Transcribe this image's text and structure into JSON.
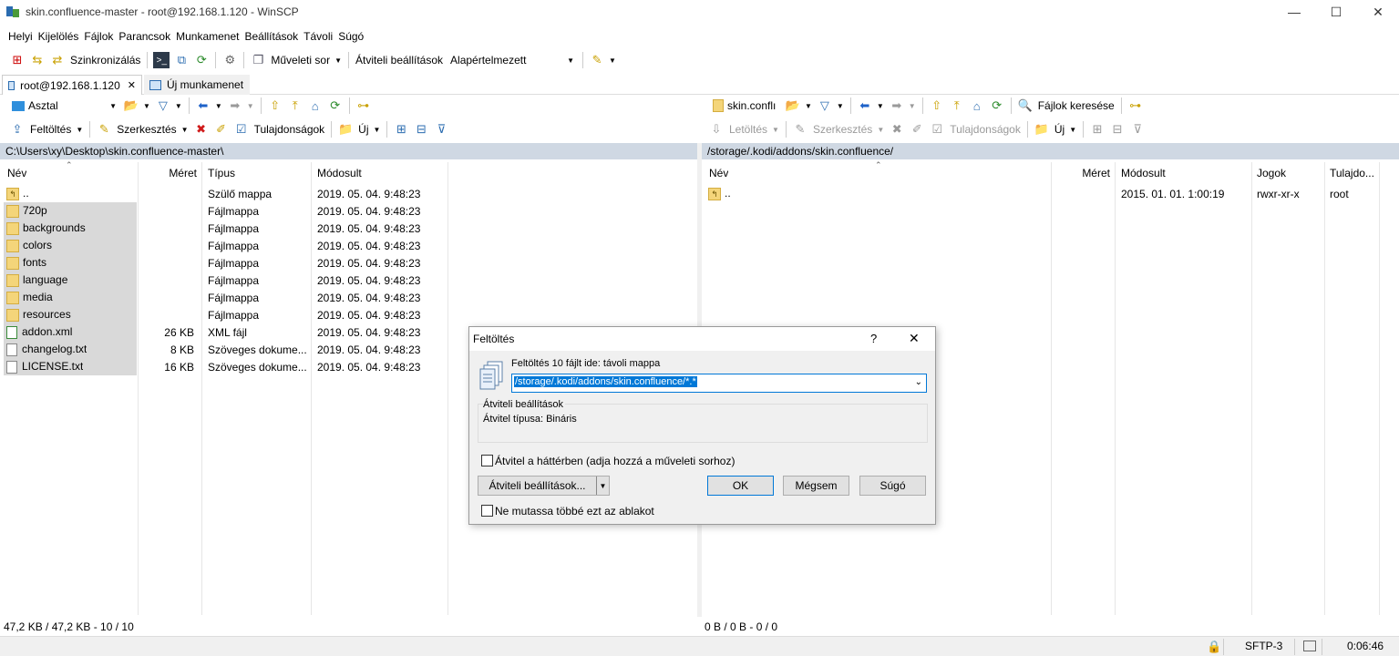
{
  "window": {
    "title": "skin.confluence-master - root@192.168.1.120 - WinSCP",
    "minimize": "—",
    "maximize": "☐",
    "close": "✕"
  },
  "menu": [
    "Helyi",
    "Kijelölés",
    "Fájlok",
    "Parancsok",
    "Munkamenet",
    "Beállítások",
    "Távoli",
    "Súgó"
  ],
  "toolbar": {
    "sync_label": "Szinkronizálás",
    "queue_label": "Műveleti sor",
    "transfer_settings_label": "Átviteli beállítások",
    "transfer_preset": "Alapértelmezett"
  },
  "tabs": {
    "active_label": "root@192.168.1.120",
    "close_glyph": "✕",
    "new_session_label": "Új munkamenet"
  },
  "left": {
    "drive_label": "Asztal",
    "upload_label": "Feltöltés",
    "edit_label": "Szerkesztés",
    "properties_label": "Tulajdonságok",
    "new_label": "Új",
    "path": "C:\\Users\\xy\\Desktop\\skin.confluence-master\\",
    "columns": {
      "name": "Név",
      "size": "Méret",
      "type": "Típus",
      "modified": "Módosult"
    },
    "files": [
      {
        "name": "..",
        "size": "",
        "type": "Szülő mappa",
        "modified": "2019. 05. 04.  9:48:23",
        "kind": "up"
      },
      {
        "name": "720p",
        "size": "",
        "type": "Fájlmappa",
        "modified": "2019. 05. 04.  9:48:23",
        "kind": "folder"
      },
      {
        "name": "backgrounds",
        "size": "",
        "type": "Fájlmappa",
        "modified": "2019. 05. 04.  9:48:23",
        "kind": "folder"
      },
      {
        "name": "colors",
        "size": "",
        "type": "Fájlmappa",
        "modified": "2019. 05. 04.  9:48:23",
        "kind": "folder"
      },
      {
        "name": "fonts",
        "size": "",
        "type": "Fájlmappa",
        "modified": "2019. 05. 04.  9:48:23",
        "kind": "folder"
      },
      {
        "name": "language",
        "size": "",
        "type": "Fájlmappa",
        "modified": "2019. 05. 04.  9:48:23",
        "kind": "folder"
      },
      {
        "name": "media",
        "size": "",
        "type": "Fájlmappa",
        "modified": "2019. 05. 04.  9:48:23",
        "kind": "folder"
      },
      {
        "name": "resources",
        "size": "",
        "type": "Fájlmappa",
        "modified": "2019. 05. 04.  9:48:23",
        "kind": "folder"
      },
      {
        "name": "addon.xml",
        "size": "26 KB",
        "type": "XML fájl",
        "modified": "2019. 05. 04.  9:48:23",
        "kind": "file"
      },
      {
        "name": "changelog.txt",
        "size": "8 KB",
        "type": "Szöveges dokume...",
        "modified": "2019. 05. 04.  9:48:23",
        "kind": "file"
      },
      {
        "name": "LICENSE.txt",
        "size": "16 KB",
        "type": "Szöveges dokume...",
        "modified": "2019. 05. 04.  9:48:23",
        "kind": "file"
      }
    ],
    "status": "47,2 KB / 47,2 KB - 10 / 10"
  },
  "right": {
    "dir_label": "skin.conflı",
    "find_label": "Fájlok keresése",
    "download_label": "Letöltés",
    "edit_label": "Szerkesztés",
    "properties_label": "Tulajdonságok",
    "new_label": "Új",
    "path": "/storage/.kodi/addons/skin.confluence/",
    "columns": {
      "name": "Név",
      "size": "Méret",
      "modified": "Módosult",
      "rights": "Jogok",
      "owner": "Tulajdo..."
    },
    "files": [
      {
        "name": "..",
        "size": "",
        "modified": "2015. 01. 01.  1:00:19",
        "rights": "rwxr-xr-x",
        "owner": "root"
      }
    ],
    "status": "0 B / 0 B - 0 / 0"
  },
  "statusbar": {
    "protocol": "SFTP-3",
    "elapsed": "0:06:46"
  },
  "dialog": {
    "title": "Feltöltés",
    "help_glyph": "?",
    "close_glyph": "✕",
    "prompt": "Feltöltés 10 fájlt ide: távoli mappa",
    "target": "/storage/.kodi/addons/skin.confluence/*.*",
    "group_title": "Átviteli beállítások",
    "transfer_type": "Átvitel típusa: Bináris",
    "background_checkbox": "Átvitel a háttérben (adja hozzá a műveleti sorhoz)",
    "settings_button": "Átviteli beállítások...",
    "ok_button": "OK",
    "cancel_button": "Mégsem",
    "help_button": "Súgó",
    "dont_show_checkbox": "Ne mutassa többé ezt az ablakot"
  }
}
